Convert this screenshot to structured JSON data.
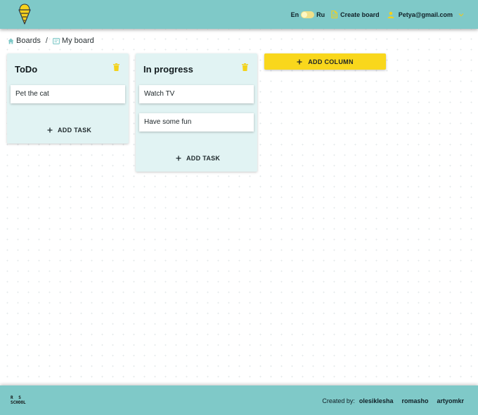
{
  "header": {
    "lang_en": "En",
    "lang_ru": "Ru",
    "create_board": "Create board",
    "user_email": "Petya@gmail.com"
  },
  "breadcrumb": {
    "boards": "Boards",
    "separator": "/",
    "current": "My board"
  },
  "columns": [
    {
      "title": "ToDo",
      "tasks": [
        "Pet the cat"
      ],
      "add_task": "ADD TASK"
    },
    {
      "title": "In progress",
      "tasks": [
        "Watch TV",
        "Have some fun"
      ],
      "add_task": "ADD TASK"
    }
  ],
  "add_column": "ADD COLUMN",
  "footer": {
    "logo_line1": "R S",
    "logo_line2": "SCHOOL",
    "created_by": "Created by:",
    "authors": [
      "olesiklesha",
      "romasho",
      "artyomkr"
    ]
  },
  "colors": {
    "header_bg": "#7fc9c8",
    "column_bg": "#e1f3f3",
    "accent_yellow": "#f9d71c"
  },
  "icons": {
    "logo": "ice-cream-icon",
    "create_board": "document-icon",
    "user": "user-icon",
    "menu": "chevron-down-icon",
    "home": "home-icon",
    "board": "board-icon",
    "delete": "trash-icon",
    "add": "plus-icon"
  }
}
